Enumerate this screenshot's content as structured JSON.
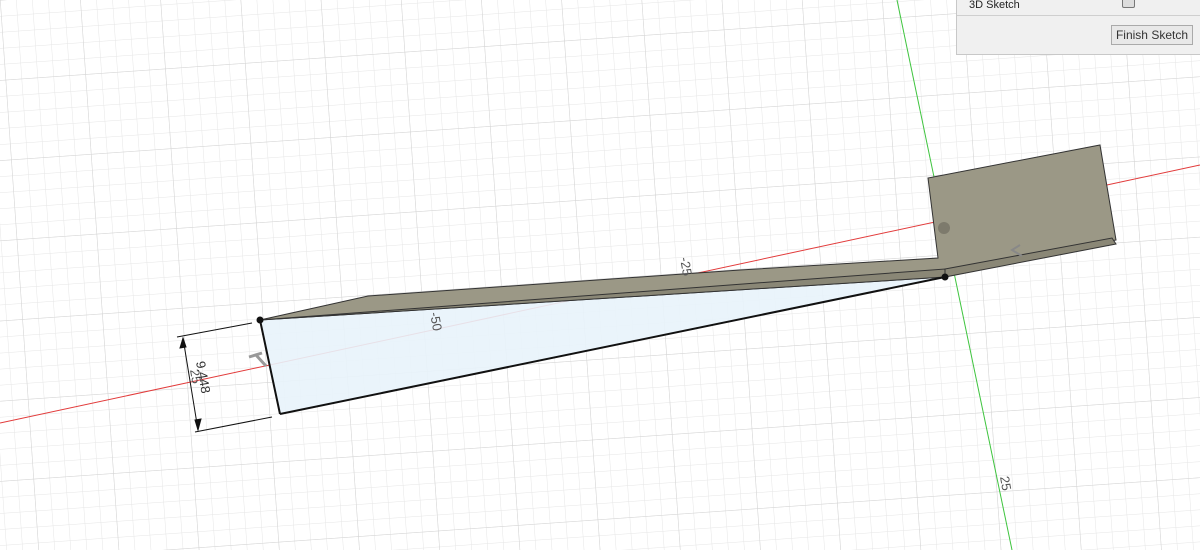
{
  "panel": {
    "sketch_3d_label": "3D Sketch",
    "sketch_3d_checked": false,
    "finish_label": "Finish Sketch"
  },
  "dimensions": {
    "height": "9.448",
    "height_behind": "25",
    "length": "-50",
    "origin_x": "-25",
    "axis_y": "25"
  },
  "colors": {
    "x_axis": "#e23b3b",
    "y_axis": "#3ec43e",
    "body": "#9b9886",
    "profile": "#e8f3fb",
    "grid": "#e4e4e4"
  }
}
